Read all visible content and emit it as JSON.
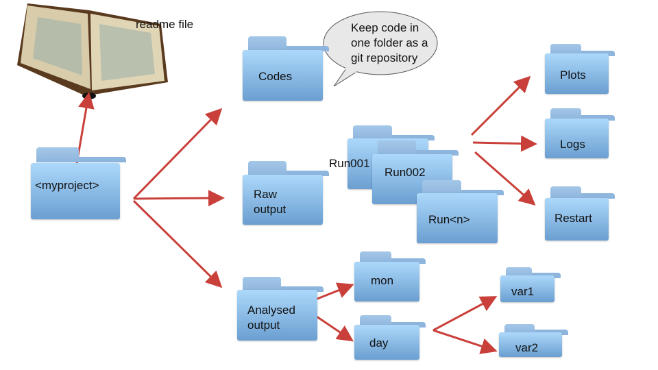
{
  "readme_label": "readme file",
  "speech_bubble": [
    "Keep code in",
    "one folder as a",
    "git repository"
  ],
  "folders": {
    "myproject": "<myproject>",
    "codes": "Codes",
    "raw_output": [
      "Raw",
      "output"
    ],
    "analysed_output": [
      "Analysed",
      "output"
    ],
    "run001": "Run001",
    "run002": "Run002",
    "runn": "Run<n>",
    "plots": "Plots",
    "logs": "Logs",
    "restart": "Restart",
    "mon": "mon",
    "day": "day",
    "var1": "var1",
    "var2": "var2"
  },
  "colors": {
    "arrow": "#c9403a",
    "folder_top": "#acd8fa",
    "folder_bottom": "#6b9fd1"
  }
}
